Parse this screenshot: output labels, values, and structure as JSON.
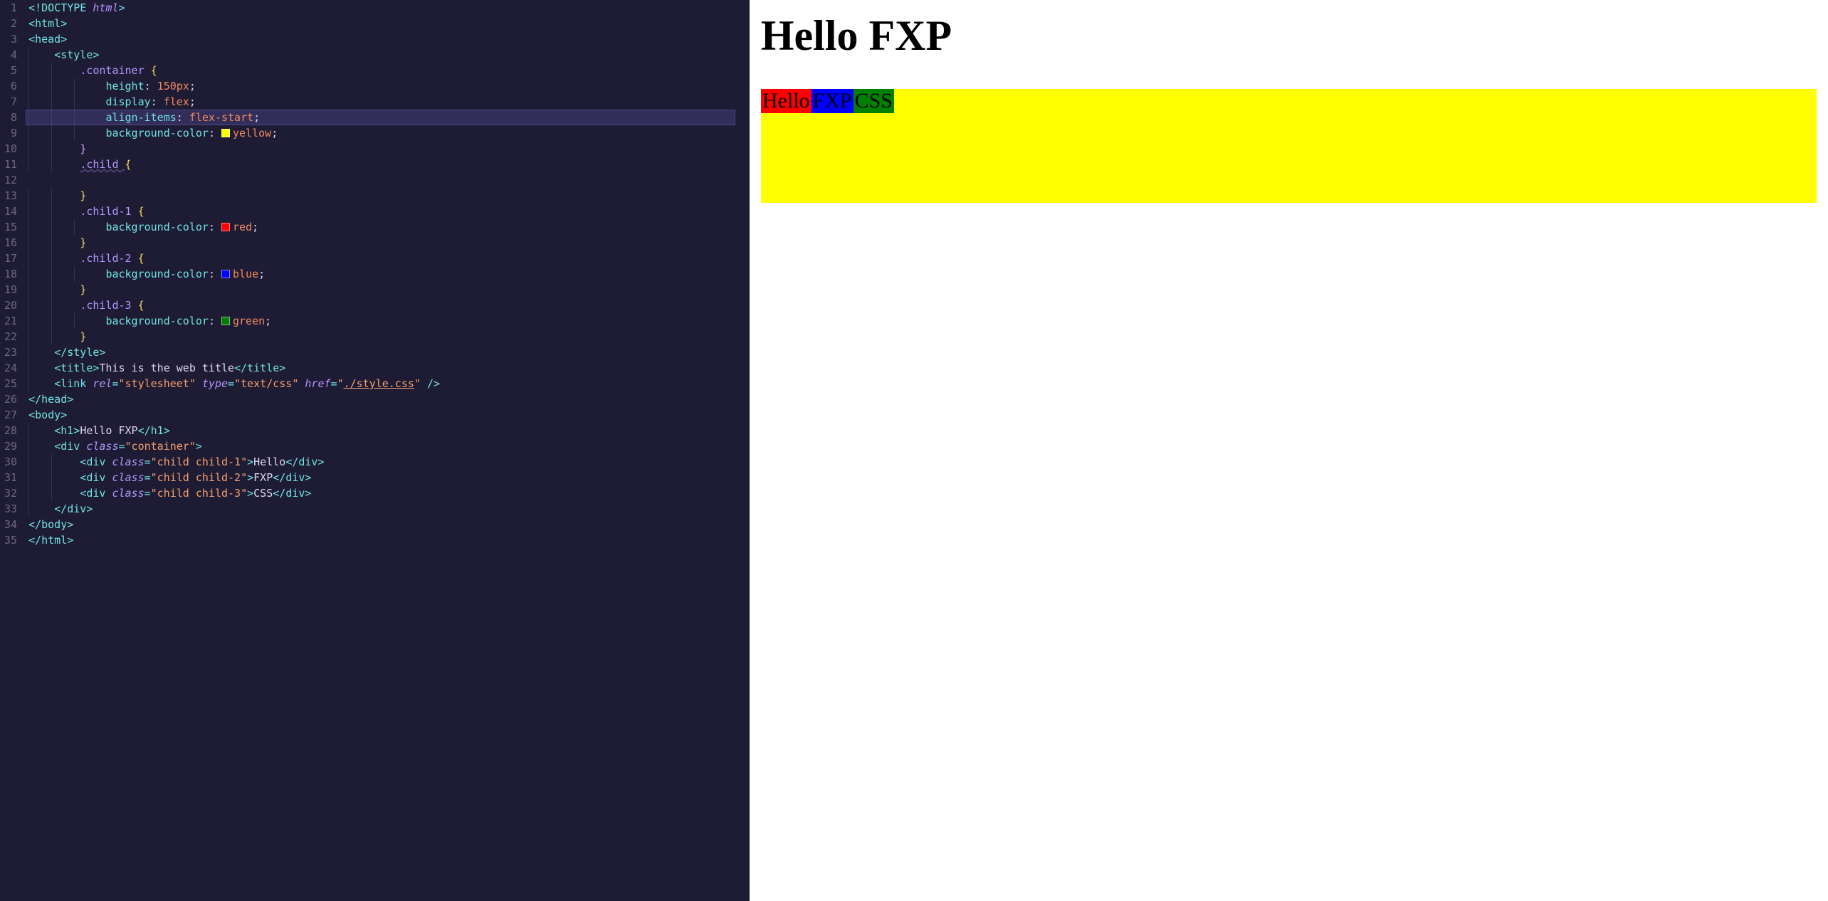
{
  "editor": {
    "total_lines": 35,
    "highlighted_line": 8,
    "lines": [
      {
        "n": 1,
        "indent": 0,
        "tokens": [
          [
            "punct",
            "<"
          ],
          [
            "doctype",
            "!DOCTYPE "
          ],
          [
            "doctype-kw",
            "html"
          ],
          [
            "punct",
            ">"
          ]
        ]
      },
      {
        "n": 2,
        "indent": 0,
        "tokens": [
          [
            "punct",
            "<"
          ],
          [
            "tag",
            "html"
          ],
          [
            "punct",
            ">"
          ]
        ]
      },
      {
        "n": 3,
        "indent": 0,
        "tokens": [
          [
            "punct",
            "<"
          ],
          [
            "tag",
            "head"
          ],
          [
            "punct",
            ">"
          ]
        ]
      },
      {
        "n": 4,
        "indent": 1,
        "tokens": [
          [
            "punct",
            "<"
          ],
          [
            "tag",
            "style"
          ],
          [
            "punct",
            ">"
          ]
        ]
      },
      {
        "n": 5,
        "indent": 2,
        "tokens": [
          [
            "selector",
            ".container "
          ],
          [
            "brace",
            "{"
          ]
        ]
      },
      {
        "n": 6,
        "indent": 3,
        "tokens": [
          [
            "prop",
            "height"
          ],
          [
            "text",
            ": "
          ],
          [
            "value",
            "150px"
          ],
          [
            "text",
            ";"
          ]
        ]
      },
      {
        "n": 7,
        "indent": 3,
        "tokens": [
          [
            "prop",
            "display"
          ],
          [
            "text",
            ": "
          ],
          [
            "value",
            "flex"
          ],
          [
            "text",
            ";"
          ]
        ]
      },
      {
        "n": 8,
        "indent": 3,
        "hl": true,
        "tokens": [
          [
            "prop",
            "align-items"
          ],
          [
            "text",
            ": "
          ],
          [
            "value",
            "flex-start"
          ],
          [
            "text",
            ";"
          ]
        ]
      },
      {
        "n": 9,
        "indent": 3,
        "tokens": [
          [
            "prop",
            "background-color"
          ],
          [
            "text",
            ": "
          ],
          [
            "swatch",
            "yellow"
          ],
          [
            "value",
            "yellow"
          ],
          [
            "text",
            ";"
          ]
        ]
      },
      {
        "n": 10,
        "indent": 2,
        "tokens": [
          [
            "brace-purple",
            "}"
          ]
        ]
      },
      {
        "n": 11,
        "indent": 2,
        "tokens": [
          [
            "selector-underline",
            ".child "
          ],
          [
            "brace",
            "{"
          ]
        ]
      },
      {
        "n": 12,
        "indent": 0,
        "tokens": []
      },
      {
        "n": 13,
        "indent": 2,
        "tokens": [
          [
            "brace",
            "}"
          ]
        ]
      },
      {
        "n": 14,
        "indent": 2,
        "tokens": [
          [
            "selector",
            ".child-1 "
          ],
          [
            "brace",
            "{"
          ]
        ]
      },
      {
        "n": 15,
        "indent": 3,
        "tokens": [
          [
            "prop",
            "background-color"
          ],
          [
            "text",
            ": "
          ],
          [
            "swatch",
            "red"
          ],
          [
            "value",
            "red"
          ],
          [
            "text",
            ";"
          ]
        ]
      },
      {
        "n": 16,
        "indent": 2,
        "tokens": [
          [
            "brace",
            "}"
          ]
        ]
      },
      {
        "n": 17,
        "indent": 2,
        "tokens": [
          [
            "selector",
            ".child-2 "
          ],
          [
            "brace",
            "{"
          ]
        ]
      },
      {
        "n": 18,
        "indent": 3,
        "tokens": [
          [
            "prop",
            "background-color"
          ],
          [
            "text",
            ": "
          ],
          [
            "swatch",
            "blue"
          ],
          [
            "value",
            "blue"
          ],
          [
            "text",
            ";"
          ]
        ]
      },
      {
        "n": 19,
        "indent": 2,
        "tokens": [
          [
            "brace",
            "}"
          ]
        ]
      },
      {
        "n": 20,
        "indent": 2,
        "tokens": [
          [
            "selector",
            ".child-3 "
          ],
          [
            "brace",
            "{"
          ]
        ]
      },
      {
        "n": 21,
        "indent": 3,
        "tokens": [
          [
            "prop",
            "background-color"
          ],
          [
            "text",
            ": "
          ],
          [
            "swatch",
            "green"
          ],
          [
            "value",
            "green"
          ],
          [
            "text",
            ";"
          ]
        ]
      },
      {
        "n": 22,
        "indent": 2,
        "tokens": [
          [
            "brace",
            "}"
          ]
        ]
      },
      {
        "n": 23,
        "indent": 1,
        "tokens": [
          [
            "punct",
            "</"
          ],
          [
            "tag",
            "style"
          ],
          [
            "punct",
            ">"
          ]
        ]
      },
      {
        "n": 24,
        "indent": 1,
        "tokens": [
          [
            "punct",
            "<"
          ],
          [
            "tag",
            "title"
          ],
          [
            "punct",
            ">"
          ],
          [
            "text",
            "This is the web title"
          ],
          [
            "punct",
            "</"
          ],
          [
            "tag",
            "title"
          ],
          [
            "punct",
            ">"
          ]
        ]
      },
      {
        "n": 25,
        "indent": 1,
        "tokens": [
          [
            "punct",
            "<"
          ],
          [
            "tag",
            "link "
          ],
          [
            "attr",
            "rel"
          ],
          [
            "punct",
            "="
          ],
          [
            "string",
            "\"stylesheet\""
          ],
          [
            "text",
            " "
          ],
          [
            "attr",
            "type"
          ],
          [
            "punct",
            "="
          ],
          [
            "string",
            "\"text/css\""
          ],
          [
            "text",
            " "
          ],
          [
            "attr",
            "href"
          ],
          [
            "punct",
            "="
          ],
          [
            "string",
            "\""
          ],
          [
            "link",
            "./style.css"
          ],
          [
            "string",
            "\""
          ],
          [
            "punct",
            " />"
          ]
        ]
      },
      {
        "n": 26,
        "indent": 0,
        "tokens": [
          [
            "punct",
            "</"
          ],
          [
            "tag",
            "head"
          ],
          [
            "punct",
            ">"
          ]
        ]
      },
      {
        "n": 27,
        "indent": 0,
        "tokens": [
          [
            "punct",
            "<"
          ],
          [
            "tag",
            "body"
          ],
          [
            "punct",
            ">"
          ]
        ]
      },
      {
        "n": 28,
        "indent": 1,
        "tokens": [
          [
            "punct",
            "<"
          ],
          [
            "tag",
            "h1"
          ],
          [
            "punct",
            ">"
          ],
          [
            "text",
            "Hello FXP"
          ],
          [
            "punct",
            "</"
          ],
          [
            "tag",
            "h1"
          ],
          [
            "punct",
            ">"
          ]
        ]
      },
      {
        "n": 29,
        "indent": 1,
        "tokens": [
          [
            "punct",
            "<"
          ],
          [
            "tag",
            "div "
          ],
          [
            "attr",
            "class"
          ],
          [
            "punct",
            "="
          ],
          [
            "string",
            "\"container\""
          ],
          [
            "punct",
            ">"
          ]
        ]
      },
      {
        "n": 30,
        "indent": 2,
        "tokens": [
          [
            "punct",
            "<"
          ],
          [
            "tag",
            "div "
          ],
          [
            "attr",
            "class"
          ],
          [
            "punct",
            "="
          ],
          [
            "string",
            "\"child child-1\""
          ],
          [
            "punct",
            ">"
          ],
          [
            "text",
            "Hello"
          ],
          [
            "punct",
            "</"
          ],
          [
            "tag",
            "div"
          ],
          [
            "punct",
            ">"
          ]
        ]
      },
      {
        "n": 31,
        "indent": 2,
        "tokens": [
          [
            "punct",
            "<"
          ],
          [
            "tag",
            "div "
          ],
          [
            "attr",
            "class"
          ],
          [
            "punct",
            "="
          ],
          [
            "string",
            "\"child child-2\""
          ],
          [
            "punct",
            ">"
          ],
          [
            "text",
            "FXP"
          ],
          [
            "punct",
            "</"
          ],
          [
            "tag",
            "div"
          ],
          [
            "punct",
            ">"
          ]
        ]
      },
      {
        "n": 32,
        "indent": 2,
        "tokens": [
          [
            "punct",
            "<"
          ],
          [
            "tag",
            "div "
          ],
          [
            "attr",
            "class"
          ],
          [
            "punct",
            "="
          ],
          [
            "string",
            "\"child child-3\""
          ],
          [
            "punct",
            ">"
          ],
          [
            "text",
            "CSS"
          ],
          [
            "punct",
            "</"
          ],
          [
            "tag",
            "div"
          ],
          [
            "punct",
            ">"
          ]
        ]
      },
      {
        "n": 33,
        "indent": 1,
        "tokens": [
          [
            "punct",
            "</"
          ],
          [
            "tag",
            "div"
          ],
          [
            "punct",
            ">"
          ]
        ]
      },
      {
        "n": 34,
        "indent": 0,
        "tokens": [
          [
            "punct",
            "</"
          ],
          [
            "tag",
            "body"
          ],
          [
            "punct",
            ">"
          ]
        ]
      },
      {
        "n": 35,
        "indent": 0,
        "tokens": [
          [
            "punct",
            "</"
          ],
          [
            "tag",
            "html"
          ],
          [
            "punct",
            ">"
          ]
        ]
      }
    ]
  },
  "preview": {
    "heading": "Hello FXP",
    "container_bg": "yellow",
    "children": [
      {
        "text": "Hello",
        "bg": "red"
      },
      {
        "text": "FXP",
        "bg": "blue"
      },
      {
        "text": "CSS",
        "bg": "green"
      }
    ]
  }
}
